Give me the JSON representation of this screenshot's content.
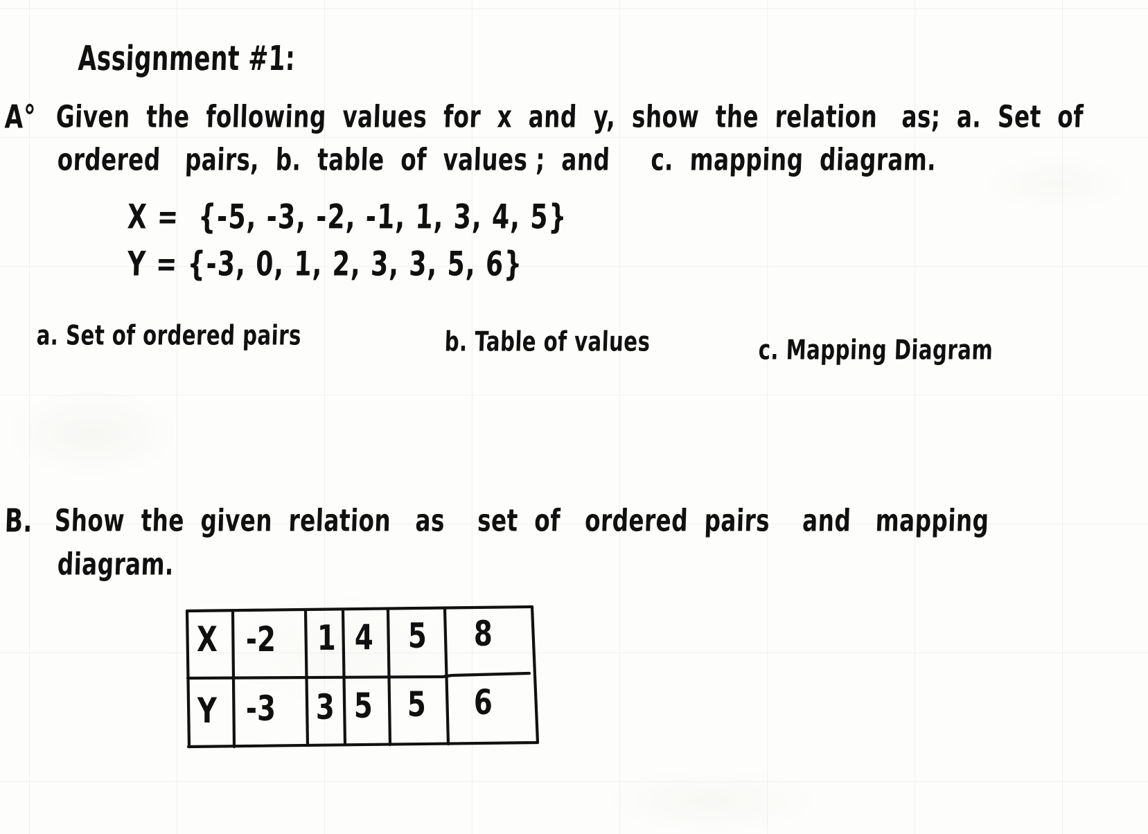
{
  "document": {
    "title": "Assignment #1:",
    "media": "handwritten worksheet on faint grid notebook paper",
    "ink_color": "#101010",
    "paper_color": "#fdfdfb"
  },
  "section_a": {
    "marker": "A°",
    "instruction_line_1": "Given  the  following  values  for  x  and  y,  show  the  relation   as;  a.  Set  of",
    "instruction_line_2": "ordered   pairs,  b.  table  of  values ;  and     c.  mapping  diagram.",
    "equations": {
      "x_line": "X =  {-5, -3, -2, -1, 1, 3, 4, 5}",
      "y_line": "Y = {-3, 0, 1, 2, 3, 3, 5, 6}",
      "x_label": "X",
      "y_label": "Y",
      "x_values": [
        -5,
        -3,
        -2,
        -1,
        1,
        3,
        4,
        5
      ],
      "y_values": [
        -3,
        0,
        1,
        2,
        3,
        3,
        5,
        6
      ]
    },
    "subparts": [
      {
        "key": "a",
        "label": "a. Set of ordered pairs"
      },
      {
        "key": "b",
        "label": "b. Table of values"
      },
      {
        "key": "c",
        "label": "c. Mapping Diagram"
      }
    ]
  },
  "section_b": {
    "marker": "B.",
    "instruction_line_1": "Show  the  given  relation   as    set  of   ordered  pairs    and   mapping",
    "instruction_line_2": "diagram.",
    "table": {
      "rows": [
        {
          "header": "X",
          "cells": [
            "-2",
            "1",
            "4",
            "5",
            "8"
          ]
        },
        {
          "header": "Y",
          "cells": [
            "-3",
            "3",
            "5",
            "5",
            "6"
          ]
        }
      ]
    }
  }
}
